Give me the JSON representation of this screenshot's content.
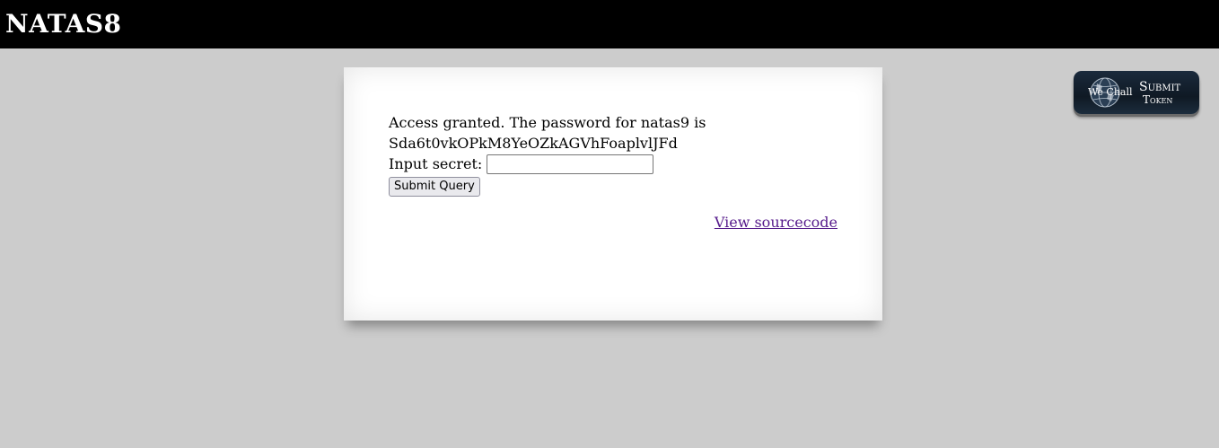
{
  "header": {
    "title": "NATAS8"
  },
  "content": {
    "access_message": "Access granted. The password for natas9 is",
    "password": "Sda6t0vkOPkM8YeOZkAGVhFoaplvlJFd",
    "secret_label": "Input secret:",
    "secret_value": "",
    "submit_label": "Submit Query",
    "viewsource_label": "View sourcecode"
  },
  "wechall": {
    "brand": "We Chall",
    "line1": "Submit",
    "line2": "Token",
    "icon": "globe-icon"
  },
  "colors": {
    "header_bg": "#000000",
    "page_bg": "#cccccc",
    "link": "#551a8b",
    "badge_bg": "#0f1924"
  }
}
